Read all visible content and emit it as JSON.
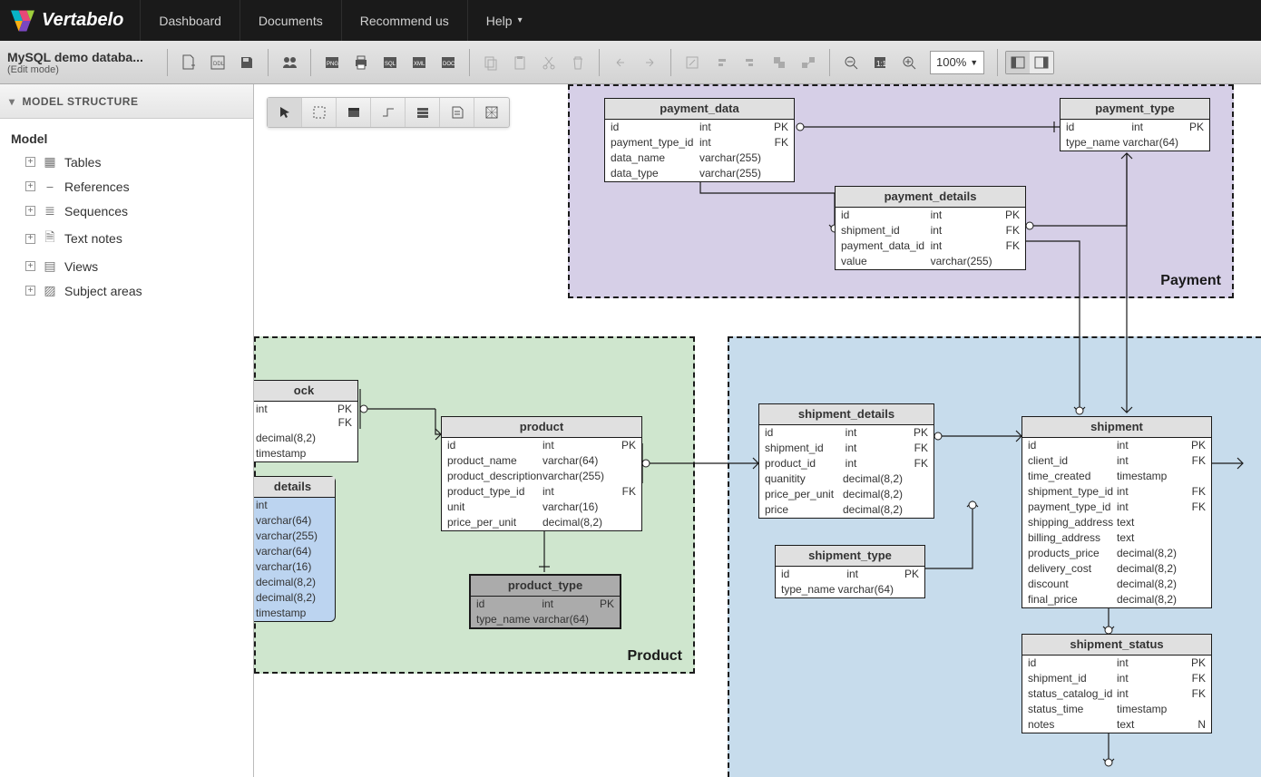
{
  "nav": {
    "dashboard": "Dashboard",
    "documents": "Documents",
    "recommend": "Recommend us",
    "help": "Help"
  },
  "doc": {
    "name": "MySQL demo databa...",
    "mode": "(Edit mode)"
  },
  "zoom": "100%",
  "side": {
    "title": "MODEL STRUCTURE",
    "root": "Model",
    "items": [
      "Tables",
      "References",
      "Sequences",
      "Text notes",
      "Views",
      "Subject areas"
    ]
  },
  "areas": {
    "payment": "Payment",
    "product": "Product"
  },
  "tables": {
    "payment_data": {
      "title": "payment_data",
      "rows": [
        [
          "id",
          "int",
          "PK"
        ],
        [
          "payment_type_id",
          "int",
          "FK"
        ],
        [
          "data_name",
          "varchar(255)",
          ""
        ],
        [
          "data_type",
          "varchar(255)",
          ""
        ]
      ]
    },
    "payment_type": {
      "title": "payment_type",
      "rows": [
        [
          "id",
          "int",
          "PK"
        ],
        [
          "type_name",
          "varchar(64)",
          ""
        ]
      ]
    },
    "payment_details": {
      "title": "payment_details",
      "rows": [
        [
          "id",
          "int",
          "PK"
        ],
        [
          "shipment_id",
          "int",
          "FK"
        ],
        [
          "payment_data_id",
          "int",
          "FK"
        ],
        [
          "value",
          "varchar(255)",
          ""
        ]
      ]
    },
    "stock": {
      "title": "ock",
      "rows": [
        [
          "",
          "int",
          "PK FK"
        ],
        [
          "",
          "decimal(8,2)",
          ""
        ],
        [
          "",
          "timestamp",
          ""
        ]
      ]
    },
    "details": {
      "title": "details",
      "rows": [
        [
          "",
          "int",
          ""
        ],
        [
          "",
          "varchar(64)",
          ""
        ],
        [
          "",
          "varchar(255)",
          ""
        ],
        [
          "",
          "varchar(64)",
          ""
        ],
        [
          "",
          "varchar(16)",
          ""
        ],
        [
          "",
          "decimal(8,2)",
          ""
        ],
        [
          "",
          "decimal(8,2)",
          ""
        ],
        [
          "",
          "timestamp",
          ""
        ]
      ]
    },
    "product": {
      "title": "product",
      "rows": [
        [
          "id",
          "int",
          "PK"
        ],
        [
          "product_name",
          "varchar(64)",
          ""
        ],
        [
          "product_description",
          "varchar(255)",
          ""
        ],
        [
          "product_type_id",
          "int",
          "FK"
        ],
        [
          "unit",
          "varchar(16)",
          ""
        ],
        [
          "price_per_unit",
          "decimal(8,2)",
          ""
        ]
      ]
    },
    "product_type": {
      "title": "product_type",
      "rows": [
        [
          "id",
          "int",
          "PK"
        ],
        [
          "type_name",
          "varchar(64)",
          ""
        ]
      ]
    },
    "shipment_details": {
      "title": "shipment_details",
      "rows": [
        [
          "id",
          "int",
          "PK"
        ],
        [
          "shipment_id",
          "int",
          "FK"
        ],
        [
          "product_id",
          "int",
          "FK"
        ],
        [
          "quanitity",
          "decimal(8,2)",
          ""
        ],
        [
          "price_per_unit",
          "decimal(8,2)",
          ""
        ],
        [
          "price",
          "decimal(8,2)",
          ""
        ]
      ]
    },
    "shipment_type": {
      "title": "shipment_type",
      "rows": [
        [
          "id",
          "int",
          "PK"
        ],
        [
          "type_name",
          "varchar(64)",
          ""
        ]
      ]
    },
    "shipment": {
      "title": "shipment",
      "rows": [
        [
          "id",
          "int",
          "PK"
        ],
        [
          "client_id",
          "int",
          "FK"
        ],
        [
          "time_created",
          "timestamp",
          ""
        ],
        [
          "shipment_type_id",
          "int",
          "FK"
        ],
        [
          "payment_type_id",
          "int",
          "FK"
        ],
        [
          "shipping_address",
          "text",
          ""
        ],
        [
          "billing_address",
          "text",
          ""
        ],
        [
          "products_price",
          "decimal(8,2)",
          ""
        ],
        [
          "delivery_cost",
          "decimal(8,2)",
          ""
        ],
        [
          "discount",
          "decimal(8,2)",
          ""
        ],
        [
          "final_price",
          "decimal(8,2)",
          ""
        ]
      ]
    },
    "shipment_status": {
      "title": "shipment_status",
      "rows": [
        [
          "id",
          "int",
          "PK"
        ],
        [
          "shipment_id",
          "int",
          "FK"
        ],
        [
          "status_catalog_id",
          "int",
          "FK"
        ],
        [
          "status_time",
          "timestamp",
          ""
        ],
        [
          "notes",
          "text",
          "N"
        ]
      ]
    }
  }
}
